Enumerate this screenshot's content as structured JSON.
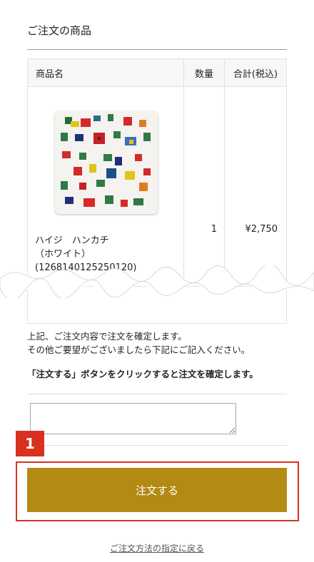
{
  "section": {
    "title": "ご注文の商品"
  },
  "table": {
    "headers": {
      "name": "商品名",
      "qty": "数量",
      "total": "合計(税込)"
    },
    "item": {
      "name_line1": "ハイジ　ハンカチ",
      "name_line2": "（ホワイト）",
      "name_line3": "(1268140125250120)",
      "qty": "1",
      "total": "¥2,750"
    }
  },
  "notice": {
    "line1": "上記、ご注文内容で注文を確定します。",
    "line2": "その他ご要望がございましたら下記にご記入ください。",
    "bold": "「注文する」ボタンをクリックすると注文を確定します。"
  },
  "annotation": {
    "step": "1"
  },
  "buttons": {
    "order": "注文する"
  },
  "links": {
    "back": "ご注文方法の指定に戻る"
  },
  "colors": {
    "order_button": "#b28a14",
    "annotation": "#d9301f"
  }
}
